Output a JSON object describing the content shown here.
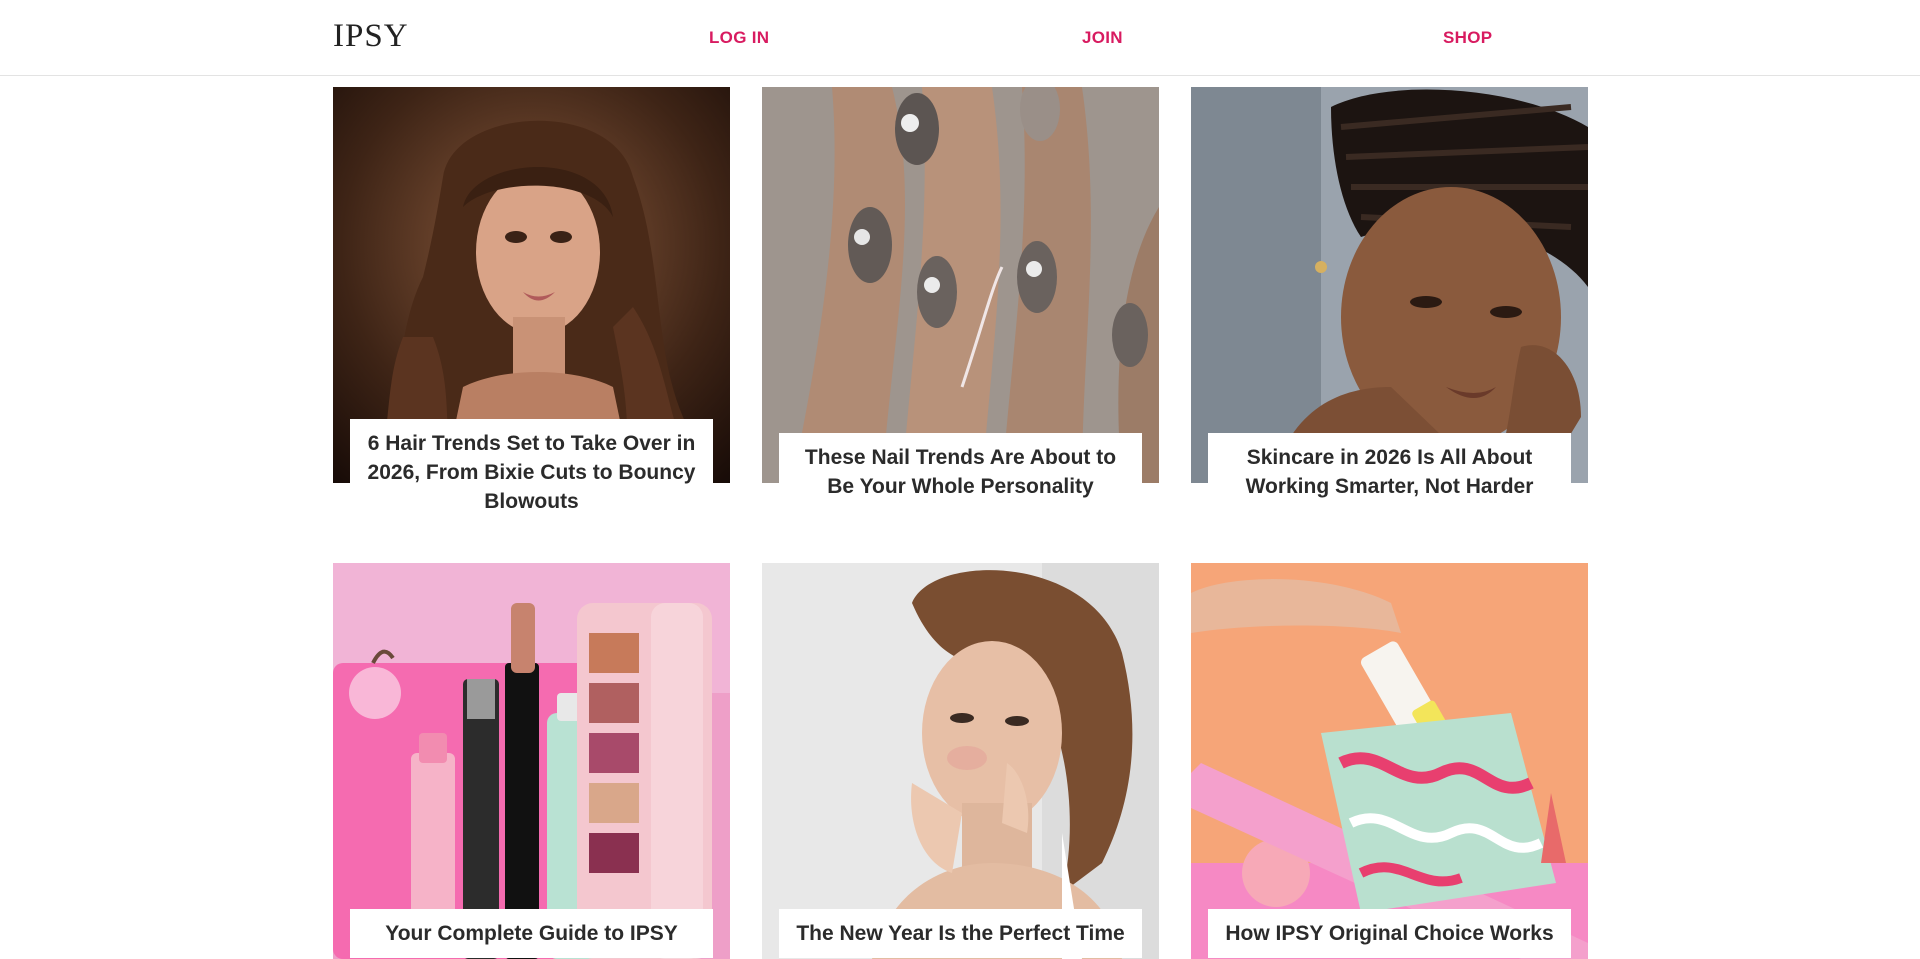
{
  "header": {
    "logo": "IPSY",
    "nav": {
      "login": "LOG IN",
      "join": "JOIN",
      "shop": "SHOP"
    }
  },
  "articles": [
    {
      "title": "6 Hair Trends Set to Take Over in 2026, From Bixie Cuts to Bouncy Blowouts"
    },
    {
      "title": "These Nail Trends Are About to Be Your Whole Personality"
    },
    {
      "title": "Skincare in 2026 Is All About Working Smarter, Not Harder"
    },
    {
      "title": "Your Complete Guide to IPSY"
    },
    {
      "title": "The New Year Is the Perfect Time"
    },
    {
      "title": "How IPSY Original Choice Works"
    }
  ],
  "colors": {
    "accent": "#d81b60",
    "text": "#2b2b2b",
    "divider": "#e3e3e3"
  }
}
